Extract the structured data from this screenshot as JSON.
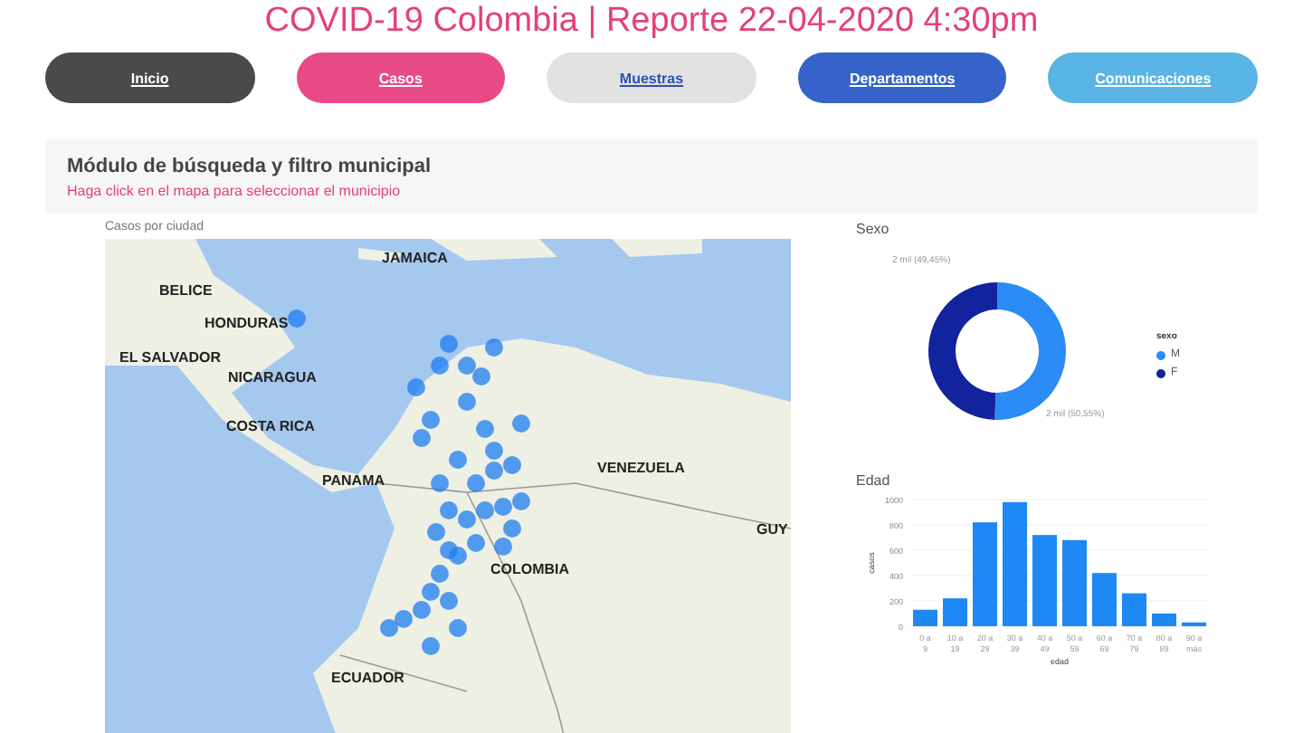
{
  "title": "COVID-19 Colombia | Reporte 22-04-2020 4:30pm",
  "nav": [
    {
      "label": "Inicio",
      "color": "#4a4a4a"
    },
    {
      "label": "Casos",
      "color": "#e84a86"
    },
    {
      "label": "Muestras",
      "color": "#e2e2e2"
    },
    {
      "label": "Departamentos",
      "color": "#3563c9"
    },
    {
      "label": "Comunicaciones",
      "color": "#5ab4e5"
    }
  ],
  "module": {
    "title": "Módulo de búsqueda y filtro municipal",
    "hint": "Haga click en el mapa para seleccionar el municipio"
  },
  "map": {
    "title": "Casos por ciudad",
    "labels": [
      "JAMAICA",
      "BELICE",
      "HONDURAS",
      "EL SALVADOR",
      "NICARAGUA",
      "COSTA RICA",
      "PANAMA",
      "VENEZUELA",
      "COLOMBIA",
      "ECUADOR",
      "GUY"
    ]
  },
  "sex": {
    "title": "Sexo",
    "chart_data": {
      "type": "donut",
      "categories": [
        "M",
        "F"
      ],
      "series": [
        {
          "name": "sexo",
          "values": [
            50.55,
            49.45
          ]
        }
      ],
      "colors": [
        "#2a8cf4",
        "#12239e"
      ],
      "value_labels": [
        "2 mil (50,55%)",
        "2 mil (49,45%)"
      ]
    }
  },
  "age": {
    "title": "Edad",
    "chart_data": {
      "type": "bar",
      "xlabel": "edad",
      "ylabel": "casos",
      "categories": [
        "0 a 9",
        "10 a 19",
        "20 a 29",
        "30 a 39",
        "40 a 49",
        "50 a 59",
        "60 a 69",
        "70 a 79",
        "80 a 89",
        "90 a más"
      ],
      "series": [
        {
          "color": "#1e88f5",
          "values": [
            130,
            220,
            820,
            980,
            720,
            680,
            420,
            260,
            100,
            30
          ]
        }
      ],
      "ylim": [
        0,
        1000
      ],
      "grid": true,
      "yticks": [
        0,
        200,
        400,
        600,
        800,
        1000
      ]
    }
  }
}
